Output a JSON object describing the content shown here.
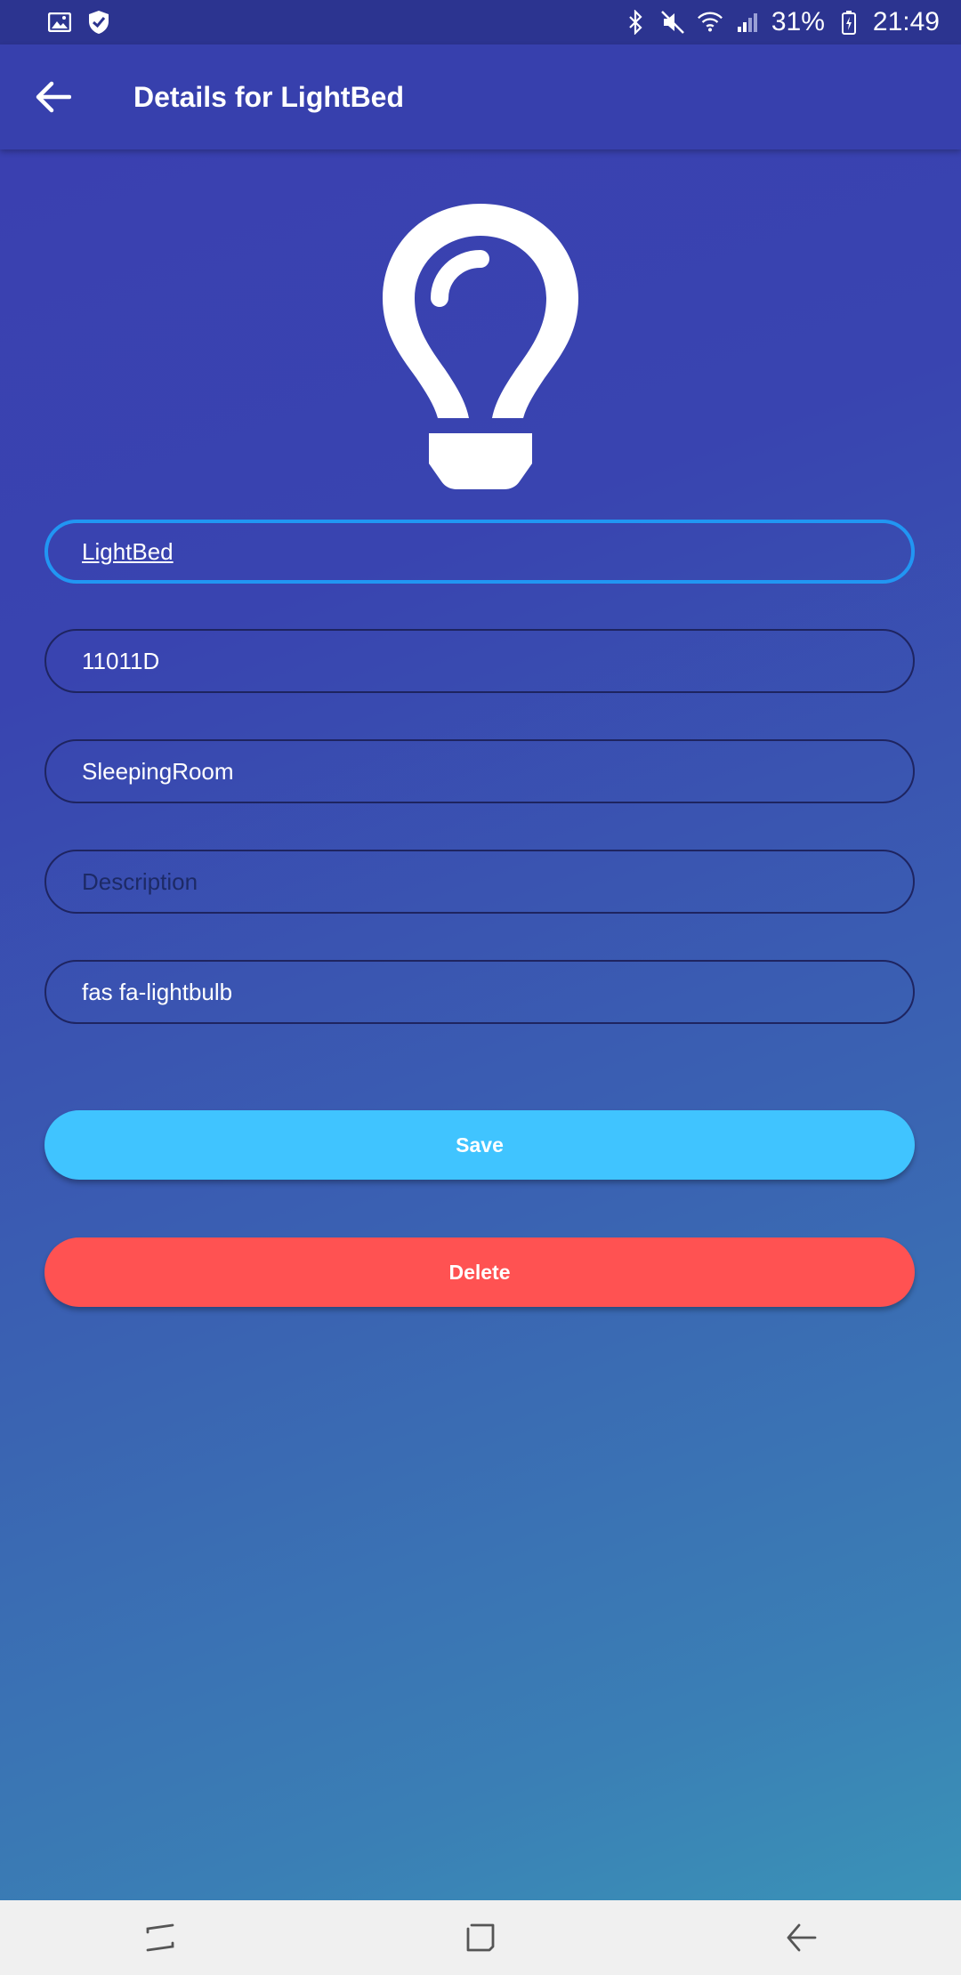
{
  "status_bar": {
    "battery_percent": "31%",
    "time": "21:49",
    "icons": [
      "gallery-icon",
      "shield-check-icon",
      "bluetooth-icon",
      "mute-icon",
      "wifi-icon",
      "signal-icon",
      "battery-icon"
    ]
  },
  "app_bar": {
    "title": "Details for LightBed"
  },
  "device": {
    "icon": "lightbulb-icon"
  },
  "form": {
    "name": {
      "value": "LightBed",
      "placeholder": ""
    },
    "code": {
      "value": "11011D",
      "placeholder": ""
    },
    "room": {
      "value": "SleepingRoom",
      "placeholder": ""
    },
    "description": {
      "value": "",
      "placeholder": "Description"
    },
    "icon_class": {
      "value": "fas fa-lightbulb",
      "placeholder": ""
    }
  },
  "actions": {
    "save_label": "Save",
    "delete_label": "Delete"
  },
  "colors": {
    "save": "#40c4ff",
    "delete": "#ff5252",
    "focus": "#2196f3"
  }
}
